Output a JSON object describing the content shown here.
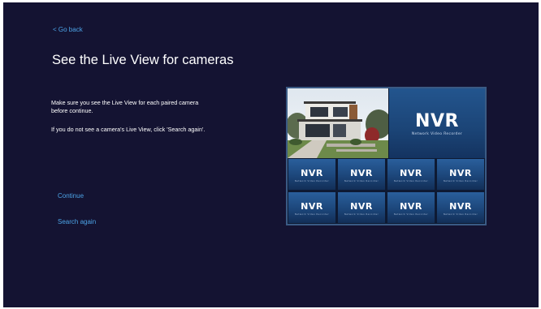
{
  "nav": {
    "back_label": "< Go back"
  },
  "page": {
    "title": "See the Live View for cameras",
    "instruction_1": "Make sure you see the Live View for each paired camera before continue.",
    "instruction_2": "If you do not see a camera's Live View, click 'Search again'."
  },
  "actions": {
    "continue_label": "Continue",
    "search_again_label": "Search again"
  },
  "live_view": {
    "main_logo": "NVR",
    "main_logo_subtitle": "Network Video Recorder",
    "tiles": [
      {
        "logo": "NVR",
        "subtitle": "Network Video Recorder"
      },
      {
        "logo": "NVR",
        "subtitle": "Network Video Recorder"
      },
      {
        "logo": "NVR",
        "subtitle": "Network Video Recorder"
      },
      {
        "logo": "NVR",
        "subtitle": "Network Video Recorder"
      },
      {
        "logo": "NVR",
        "subtitle": "Network Video Recorder"
      },
      {
        "logo": "NVR",
        "subtitle": "Network Video Recorder"
      },
      {
        "logo": "NVR",
        "subtitle": "Network Video Recorder"
      },
      {
        "logo": "NVR",
        "subtitle": "Network Video Recorder"
      }
    ]
  },
  "colors": {
    "background": "#141332",
    "link": "#4ca3e6",
    "tile": "#1c467a"
  }
}
